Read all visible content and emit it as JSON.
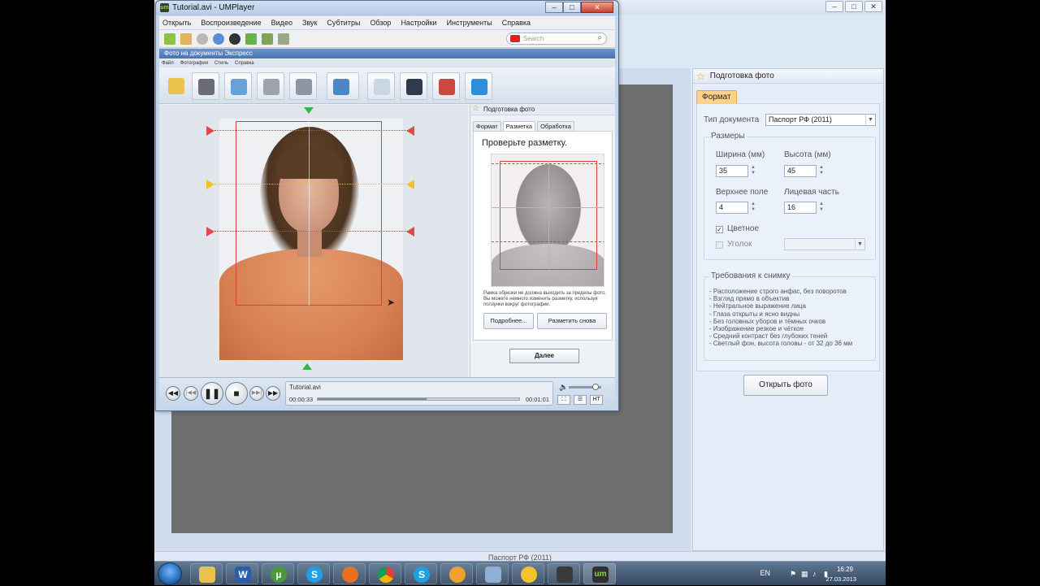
{
  "player": {
    "title": "Tutorial.avi - UMPlayer",
    "menu": [
      "Открыть",
      "Воспроизведение",
      "Видео",
      "Звук",
      "Субтитры",
      "Обзор",
      "Настройки",
      "Инструменты",
      "Справка"
    ],
    "search_placeholder": "Search",
    "file_name": "Tutorial.avi",
    "time_current": "00:00:33",
    "time_total": "00:01:01",
    "progress_fraction": 0.54,
    "volume_fraction": 0.82,
    "subtitle_btn": "НТ"
  },
  "video_app": {
    "title": "Фото на документы Экспресс",
    "menu": [
      "Файл",
      "Фотография",
      "Стиль",
      "Справка"
    ],
    "panel_title": "Подготовка фото",
    "tabs": [
      "Формат",
      "Разметка",
      "Обработка"
    ],
    "active_tab": "Разметка",
    "heading": "Проверьте разметку.",
    "note": "Рамка обрезки не должна выходить за пределы фото. Вы можете немного изменить разметку, используя ползунки вокруг фотографии.",
    "btn_more": "Подробнее...",
    "btn_remark": "Разметить снова",
    "btn_next": "Далее"
  },
  "bg_app": {
    "panel_title": "Подготовка фото",
    "tab": "Формат",
    "doc_type_label": "Тип документа",
    "doc_type_value": "Паспорт РФ (2011)",
    "sizes_title": "Размеры",
    "width_label": "Ширина (мм)",
    "width_value": "35",
    "height_label": "Высота (мм)",
    "height_value": "45",
    "top_margin_label": "Верхнее поле",
    "top_margin_value": "4",
    "face_label": "Лицевая часть",
    "face_value": "16",
    "color_label": "Цветное",
    "corner_label": "Уголок",
    "requirements_title": "Требования к снимку",
    "requirements": [
      "- Расположение строго анфас, без поворотов",
      "- Взгляд прямо в объектив",
      "- Нейтральное выражение лица",
      "- Глаза открыты и ясно видны",
      "- Без головных уборов и тёмных очков",
      "- Изображение резкое и чёткое",
      "- Средний контраст без глубоких теней",
      "- Светлый фон, высота головы - от 32 до 36 мм"
    ],
    "open_button": "Открыть фото",
    "status": "Паспорт РФ (2011)"
  },
  "taskbar": {
    "lang": "EN",
    "time": "16:29",
    "date": "27.03.2013"
  },
  "colors": {
    "accent_tab": "#ffd189",
    "crop_frame": "#d94040",
    "guide_yellow": "#e6c000",
    "marker_green": "#33b54a"
  }
}
